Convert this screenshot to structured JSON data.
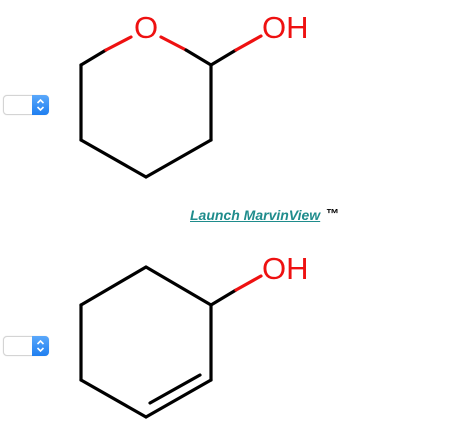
{
  "selects": [
    {
      "value": ""
    },
    {
      "value": ""
    }
  ],
  "molecules": [
    {
      "atom_labels": {
        "oxygen": "O",
        "hydroxyl": "OH"
      },
      "colors": {
        "bond": "#000000",
        "heteroatom": "#ee1111"
      }
    },
    {
      "atom_labels": {
        "hydroxyl": "OH"
      },
      "colors": {
        "bond": "#000000",
        "heteroatom": "#ee1111"
      }
    }
  ],
  "launch": {
    "link_text": "Launch MarvinView",
    "trademark": "™",
    "link_color": "#1f8c8c"
  },
  "icons": {
    "select_arrow": "chevron-up-down-icon"
  }
}
